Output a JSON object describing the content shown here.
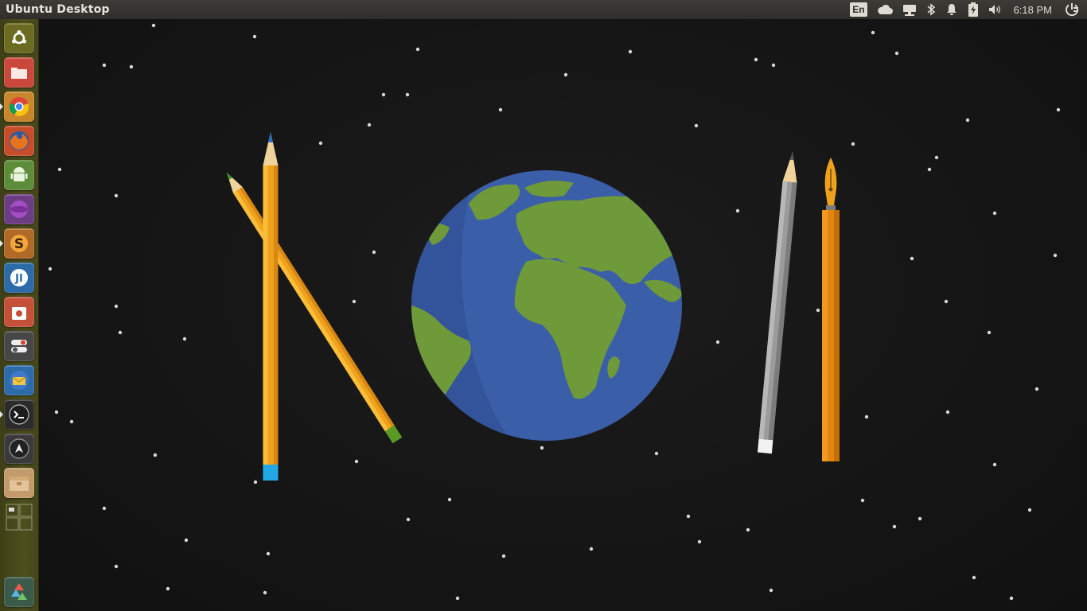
{
  "topbar": {
    "window_title": "Ubuntu Desktop",
    "language": "En",
    "clock": "6:18 PM",
    "indicators": [
      "keyboard-layout-indicator",
      "cloud-icon",
      "network-wired-icon",
      "bluetooth-icon",
      "notification-bell-icon",
      "battery-icon",
      "volume-icon",
      "session-power-icon"
    ]
  },
  "launcher": {
    "items": [
      {
        "name": "dash-home",
        "icon": "ubuntu-logo-icon",
        "color": "#6b6b22",
        "running": false
      },
      {
        "name": "files",
        "icon": "folder-icon",
        "color": "#c9483b",
        "running": false
      },
      {
        "name": "chrome",
        "icon": "chrome-icon",
        "color": "#c9862a",
        "running": true
      },
      {
        "name": "firefox",
        "icon": "firefox-icon",
        "color": "#c64d2a",
        "running": false
      },
      {
        "name": "android-studio",
        "icon": "android-icon",
        "color": "#5d8c3a",
        "running": false
      },
      {
        "name": "app-purple",
        "icon": "purple-orb-icon",
        "color": "#6d3d84",
        "running": false
      },
      {
        "name": "sublime-text",
        "icon": "sublime-icon",
        "color": "#b06a28",
        "running": true
      },
      {
        "name": "intellij",
        "icon": "intellij-icon",
        "color": "#2c6aa8",
        "running": false
      },
      {
        "name": "software-center",
        "icon": "software-bag-icon",
        "color": "#c4503a",
        "running": false
      },
      {
        "name": "system-settings",
        "icon": "toggles-icon",
        "color": "#474747",
        "running": false
      },
      {
        "name": "mail",
        "icon": "envelope-icon",
        "color": "#2d6aa8",
        "running": false
      },
      {
        "name": "terminal",
        "icon": "terminal-icon",
        "color": "#2b2b2b",
        "running": true
      },
      {
        "name": "inkscape",
        "icon": "inkscape-icon",
        "color": "#3a3a3a",
        "running": false
      },
      {
        "name": "archive",
        "icon": "package-icon",
        "color": "#c29a6b",
        "running": false
      },
      {
        "name": "workspaces",
        "icon": "workspace-switcher-icon",
        "color": "#4a4b1d",
        "running": false
      },
      {
        "name": "trash",
        "icon": "recycle-icon",
        "color": "#3a5a4a",
        "running": false
      }
    ]
  },
  "wallpaper": {
    "description_icons": [
      "green-pencil-icon",
      "blue-pencil-icon",
      "earth-globe-icon",
      "grey-pencil-icon",
      "fountain-pen-icon"
    ],
    "background": "#161616",
    "ocean": "#3a5ba8",
    "land": "#6f9a3a"
  }
}
